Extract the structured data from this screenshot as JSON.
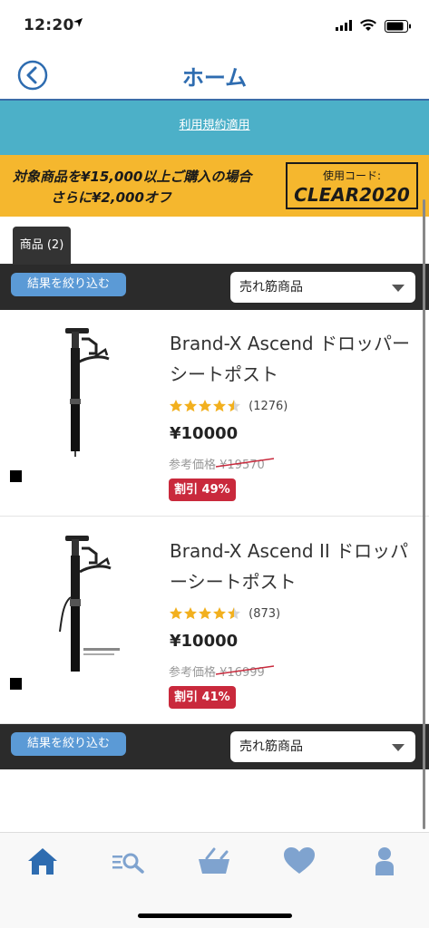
{
  "status": {
    "time": "12:20"
  },
  "nav": {
    "title": "ホーム"
  },
  "terms": {
    "link": "利用規約適用"
  },
  "promo": {
    "line1": "対象商品を¥15,000以上ご購入の場合",
    "line2": "さらに¥2,000オフ",
    "code_label": "使用コード:",
    "code": "CLEAR2020"
  },
  "tab": {
    "label": "商品 (2)"
  },
  "filter": {
    "button": "結果を絞り込む",
    "sort": "売れ筋商品"
  },
  "products": [
    {
      "name": "Brand-X Ascend ドロッパーシートポスト",
      "rating": 4.5,
      "rating_count": "(1276)",
      "price": "¥10000",
      "ref_label": "参考価格 ¥19570",
      "discount": "割引 49%"
    },
    {
      "name": "Brand-X Ascend II ドロッパーシートポスト",
      "rating": 4.5,
      "rating_count": "(873)",
      "price": "¥10000",
      "ref_label": "参考価格 ¥16999",
      "discount": "割引 41%"
    }
  ],
  "colors": {
    "accent_blue": "#2e6cb0",
    "terms_bg": "#4cb0c8",
    "promo_bg": "#f5b72e",
    "filter_bg": "#2b2b2b",
    "filter_btn": "#5b9ad6",
    "discount_bg": "#c9293c",
    "star": "#f2b01e",
    "tab_icon": "#7fa3cf"
  },
  "tabbar": {
    "items": [
      {
        "icon": "home-icon",
        "active": true
      },
      {
        "icon": "search-list-icon",
        "active": false
      },
      {
        "icon": "basket-icon",
        "active": false
      },
      {
        "icon": "heart-icon",
        "active": false
      },
      {
        "icon": "person-icon",
        "active": false
      }
    ]
  }
}
